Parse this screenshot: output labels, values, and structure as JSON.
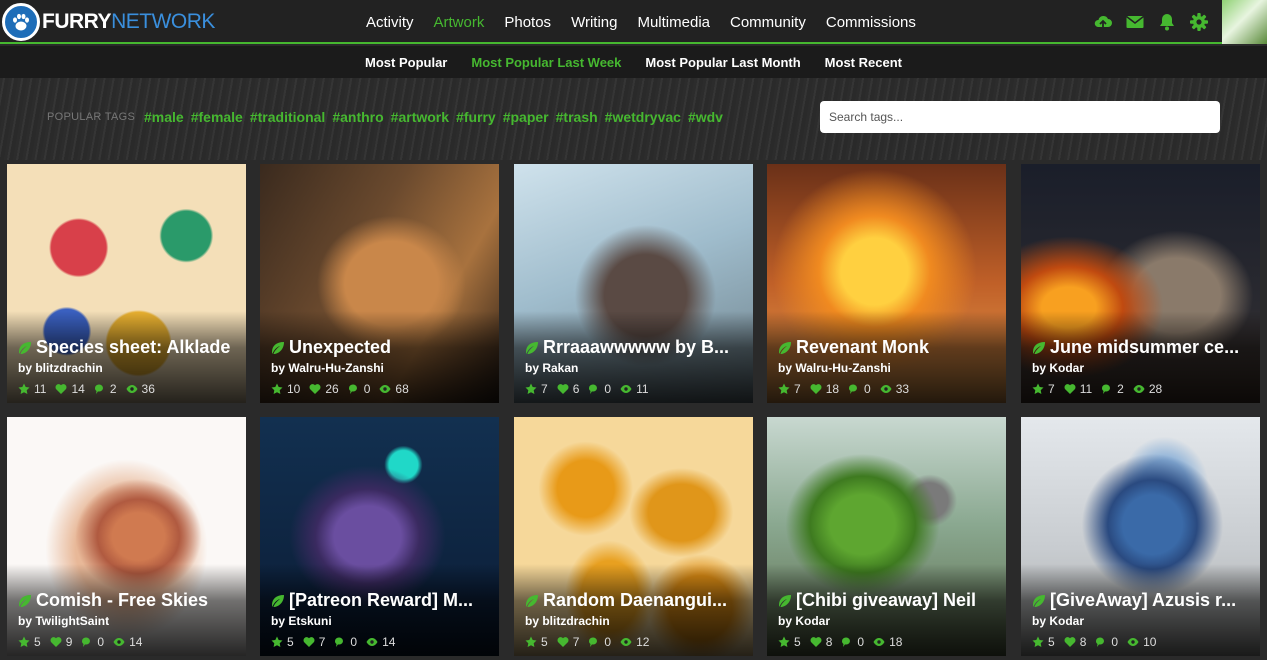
{
  "brand": {
    "name_bold": "FURRY",
    "name_light": "NETWORK"
  },
  "main_nav": [
    "Activity",
    "Artwork",
    "Photos",
    "Writing",
    "Multimedia",
    "Community",
    "Commissions"
  ],
  "main_nav_active": "Artwork",
  "header_icons": [
    "upload-icon",
    "mail-icon",
    "bell-icon",
    "gear-icon"
  ],
  "sub_nav": [
    "Most Popular",
    "Most Popular Last Week",
    "Most Popular Last Month",
    "Most Recent"
  ],
  "sub_nav_active": "Most Popular Last Week",
  "popular_tags": {
    "label": "POPULAR TAGS",
    "tags": [
      "#male",
      "#female",
      "#traditional",
      "#anthro",
      "#artwork",
      "#furry",
      "#paper",
      "#trash",
      "#wetdryvac",
      "#wdv"
    ]
  },
  "search": {
    "placeholder": "Search tags..."
  },
  "colors": {
    "accent": "#46b830",
    "topbar": "#222222",
    "background": "#2a2a2a"
  },
  "cards": [
    {
      "title": "Species sheet: Alklade",
      "author": "by blitzdrachin",
      "stars": "11",
      "likes": "14",
      "comments": "2",
      "views": "36"
    },
    {
      "title": "Unexpected",
      "author": "by Walru-Hu-Zanshi",
      "stars": "10",
      "likes": "26",
      "comments": "0",
      "views": "68"
    },
    {
      "title": "Rrraaawwwww by B...",
      "author": "by Rakan",
      "stars": "7",
      "likes": "6",
      "comments": "0",
      "views": "11"
    },
    {
      "title": "Revenant Monk",
      "author": "by Walru-Hu-Zanshi",
      "stars": "7",
      "likes": "18",
      "comments": "0",
      "views": "33"
    },
    {
      "title": "June midsummer ce...",
      "author": "by Kodar",
      "stars": "7",
      "likes": "11",
      "comments": "2",
      "views": "28"
    },
    {
      "title": "Comish - Free Skies",
      "author": "by TwilightSaint",
      "stars": "5",
      "likes": "9",
      "comments": "0",
      "views": "14"
    },
    {
      "title": "[Patreon Reward] M...",
      "author": "by Etskuni",
      "stars": "5",
      "likes": "7",
      "comments": "0",
      "views": "14"
    },
    {
      "title": "Random Daenangui...",
      "author": "by blitzdrachin",
      "stars": "5",
      "likes": "7",
      "comments": "0",
      "views": "12"
    },
    {
      "title": "[Chibi giveaway] Neil",
      "author": "by Kodar",
      "stars": "5",
      "likes": "8",
      "comments": "0",
      "views": "18"
    },
    {
      "title": "[GiveAway] Azusis r...",
      "author": "by Kodar",
      "stars": "5",
      "likes": "8",
      "comments": "0",
      "views": "10"
    }
  ]
}
